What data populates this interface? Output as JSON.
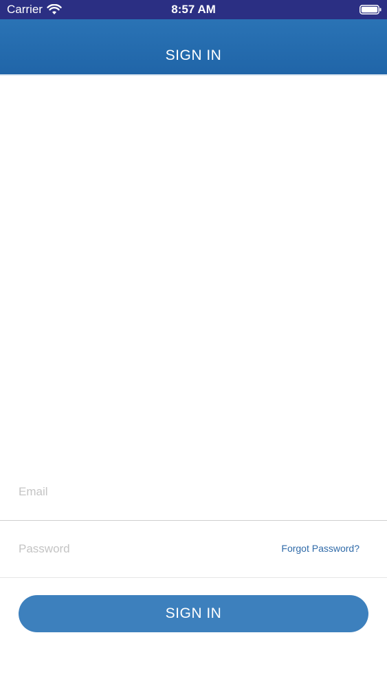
{
  "status_bar": {
    "carrier": "Carrier",
    "time": "8:57 AM"
  },
  "nav": {
    "title": "SIGN IN"
  },
  "form": {
    "email_placeholder": "Email",
    "email_value": "",
    "password_placeholder": "Password",
    "password_value": "",
    "forgot_password_label": "Forgot Password?",
    "sign_in_label": "SIGN IN"
  },
  "colors": {
    "status_bar": "#2b2f83",
    "nav_bar": "#2a73b5",
    "button": "#3d80bd",
    "link": "#2f6aa8"
  },
  "icons": {
    "wifi": "wifi-icon",
    "battery": "battery-icon"
  }
}
